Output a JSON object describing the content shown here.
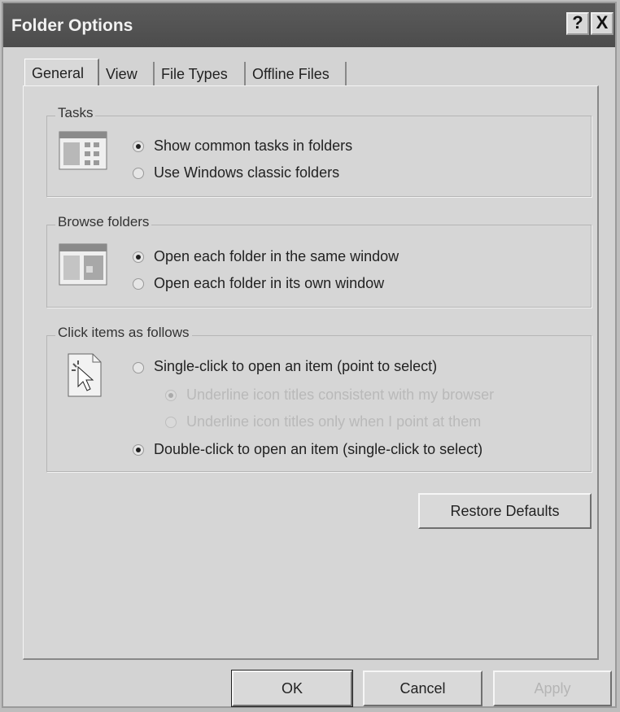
{
  "window": {
    "title": "Folder Options",
    "help_label": "?",
    "close_label": "X"
  },
  "tabs": [
    {
      "label": "General",
      "active": true
    },
    {
      "label": "View",
      "active": false
    },
    {
      "label": "File Types",
      "active": false
    },
    {
      "label": "Offline Files",
      "active": false
    }
  ],
  "tasks": {
    "legend": "Tasks",
    "icon": "tasks-folder-icon",
    "options": [
      {
        "label": "Show common tasks in folders",
        "selected": true
      },
      {
        "label": "Use Windows classic folders",
        "selected": false
      }
    ]
  },
  "browse": {
    "legend": "Browse folders",
    "icon": "browse-window-icon",
    "options": [
      {
        "label": "Open each folder in the same window",
        "selected": true
      },
      {
        "label": "Open each folder in its own window",
        "selected": false
      }
    ]
  },
  "click": {
    "legend": "Click items as follows",
    "icon": "pointer-click-icon",
    "options": [
      {
        "label": "Single-click to open an item (point to select)",
        "selected": false,
        "enabled": true
      },
      {
        "label": "Underline icon titles consistent with my browser",
        "selected": true,
        "enabled": false
      },
      {
        "label": "Underline icon titles only when I point at them",
        "selected": false,
        "enabled": false
      },
      {
        "label": "Double-click to open an item (single-click to select)",
        "selected": true,
        "enabled": true
      }
    ]
  },
  "buttons": {
    "restore": "Restore Defaults",
    "ok": "OK",
    "cancel": "Cancel",
    "apply": "Apply"
  }
}
